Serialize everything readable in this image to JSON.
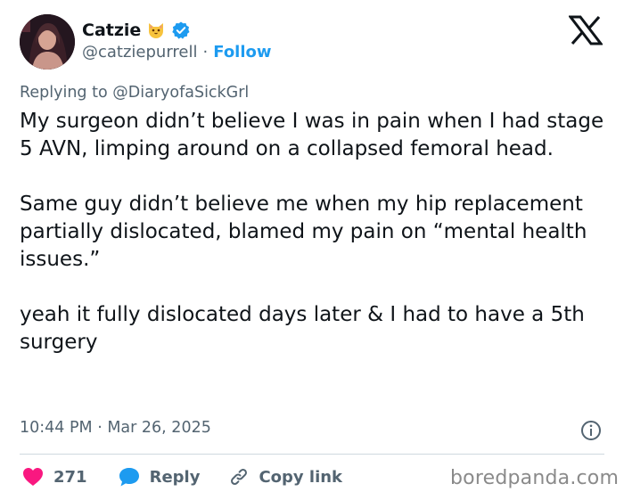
{
  "author": {
    "display_name": "Catzie",
    "handle": "@catziepurrell",
    "separator": "·",
    "follow_label": "Follow"
  },
  "replying": {
    "prefix": "Replying to",
    "mention": "@DiaryofaSickGrl"
  },
  "tweet": {
    "text": "My surgeon didn’t believe I was in pain when I had stage 5 AVN, limping around on a collapsed femoral head.\n\nSame guy didn’t believe me when my hip replacement partially dislocated, blamed my pain on “mental health issues.”\n\nyeah it fully dislocated days later & I had to have a 5th surgery",
    "timestamp": "10:44 PM · Mar 26, 2025"
  },
  "actions": {
    "likes_count": "271",
    "reply_label": "Reply",
    "copy_link_label": "Copy link"
  },
  "watermark": "boredpanda.com",
  "colors": {
    "accent": "#1d9bf0",
    "like": "#f91880",
    "text_primary": "#0f1419",
    "text_secondary": "#536471",
    "divider": "#cfd9de"
  },
  "icons": [
    "avatar-photo",
    "cat-face-emoji",
    "verified-badge-icon",
    "x-logo-icon",
    "info-icon",
    "heart-icon",
    "chat-bubble-icon",
    "link-icon"
  ]
}
